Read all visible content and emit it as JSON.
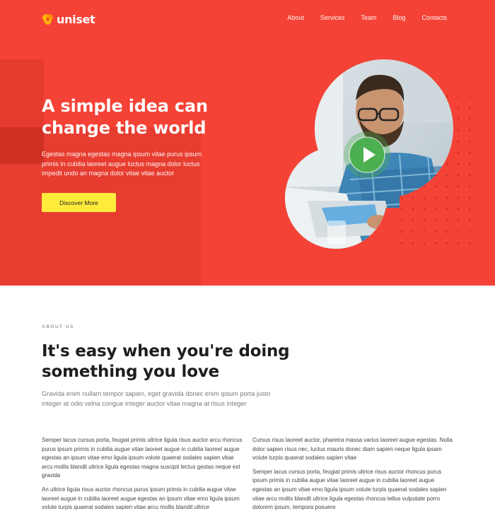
{
  "brand": {
    "name": "uniset",
    "accent": "#f44336",
    "button_color": "#ffeb3b"
  },
  "nav": {
    "items": [
      "About",
      "Services",
      "Team",
      "Blog",
      "Contacts"
    ]
  },
  "hero": {
    "title_line1": "A simple idea can",
    "title_line2": "change the world",
    "text": "Egestas magna egestas magna ipsum vitae purus ipsum primis in cubilia laoreet augue luctus magna dolor luctus impedit undo an magna dolor vitae vitae auctor",
    "button": "Discover More",
    "play_icon": "play-icon"
  },
  "about": {
    "eyebrow": "ABOUT US",
    "title_line1": "It's easy when you're doing",
    "title_line2": "something you love",
    "lead": "Gravida enim nullam tempor sapien, eget gravida donec enim ipsum porta justo integer at odio velna congue integer auctor vitae magna at risus integer",
    "col_left": [
      "Semper lacus cursus porta, feugiat primis ultrice ligula risus auctor arcu rhoncus purus ipsum primis in cubilia augue vitae laoreet augue in cubilia laoreet augue egestas an ipsum vitae emo ligula ipsum volute quaerat sodales sapien vitae arcu mollis blandit ultrice ligula egestas magna suscipit lectus gestas neque est gravida",
      "An ultrice ligula risus auctor rhoncus purus ipsum primis in cubilia augue vitae laoreet augue in cubilia laoreet augue egestas an ipsum vitae emo ligula ipsum volute turpis quaerat sodales sapien vitae arcu mollis blandit ultrice"
    ],
    "col_right": [
      "Cursus risus laoreet auctor, pharetra massa varius laoreet augue egestas. Nulla dolor sapien risus nec, luctus mauris donec diam sapien neque ligula ipsam volute turpis quaerat sodales sapien vitae",
      "Semper lacus cursus porta, feugiat primis ultrice risus auctor rhoncus purus ipsum primis in cubilia augue vitae laoreet augue in cubilia laoreet augue egestas an ipsum vitae emo ligula ipsum volute turpis quaerat sodales sapien vitae arcu mollis blandit ultrice ligula egestas rhoncus tellus vulputate porro dolorem ipsum, tempora posuere"
    ]
  }
}
